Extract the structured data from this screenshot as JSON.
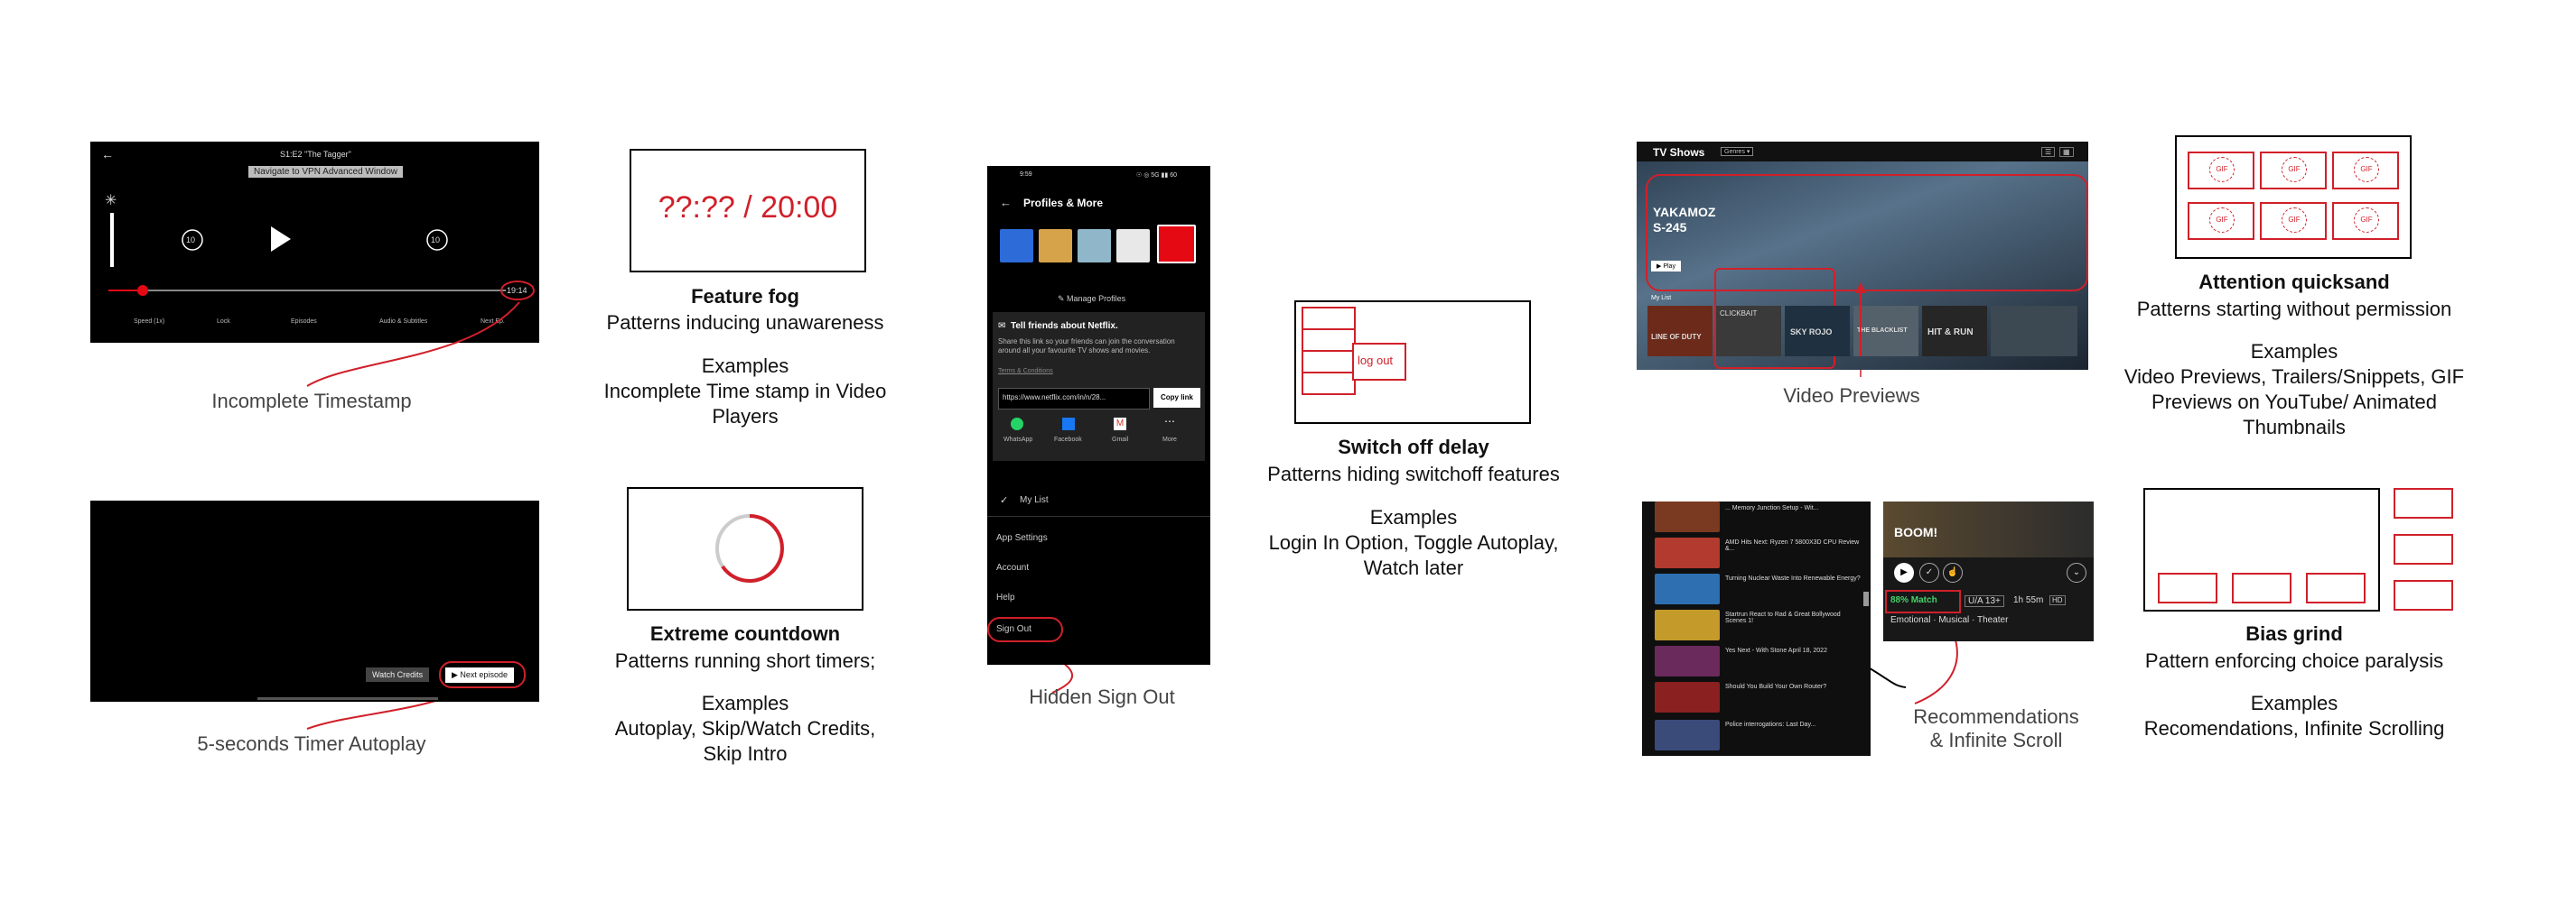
{
  "panel1": {
    "episode_title": "S1:E2 \"The Tagger\"",
    "vpn_banner": "Navigate to VPN Advanced Window",
    "skip_back": "10",
    "skip_fwd": "10",
    "timestamp": "19:14",
    "controls": [
      "Speed (1x)",
      "Lock",
      "Episodes",
      "Audio & Subtitles",
      "Next Ep."
    ],
    "caption": "Incomplete Timestamp"
  },
  "panel2": {
    "watch_credits": "Watch Credits",
    "next_episode": "Next episode",
    "caption": "5-seconds Timer Autoplay"
  },
  "feature_fog": {
    "display": "??:?? / 20:00",
    "title": "Feature fog",
    "subtitle": "Patterns inducing unawareness",
    "examples_label": "Examples",
    "examples": "Incomplete Time stamp in Video Players"
  },
  "extreme_countdown": {
    "title": "Extreme countdown",
    "subtitle": "Patterns running short timers;",
    "examples_label": "Examples",
    "examples": "Autoplay, Skip/Watch Credits, Skip Intro"
  },
  "phone": {
    "time": "9:59",
    "status_icons": "☉ ◎ 5G ▮▮ 60",
    "header": "Profiles & More",
    "manage_profiles": "Manage Profiles",
    "tell_friends": "Tell friends about Netflix.",
    "share_text": "Share this link so your friends can join the conversation around all your favourite TV shows and movies.",
    "terms": "Terms & Conditions",
    "link": "https://www.netflix.com/in/n/28...",
    "copy_link": "Copy link",
    "share_apps": [
      "WhatsApp",
      "Facebook",
      "Gmail",
      "More"
    ],
    "my_list": "My List",
    "menu": [
      "App Settings",
      "Account",
      "Help"
    ],
    "sign_out": "Sign Out",
    "caption": "Hidden Sign Out"
  },
  "switch_off": {
    "logout_label": "log out",
    "title": "Switch off delay",
    "subtitle": "Patterns hiding switchoff features",
    "examples_label": "Examples",
    "examples": "Login In Option, Toggle Autoplay, Watch later"
  },
  "tv_shows": {
    "header": "TV Shows",
    "genres": "Genres ▾",
    "show_title": "YAKAMOZ S-245",
    "play": "▶ Play",
    "my_list": "My List",
    "row_titles": [
      "LINE OF DUTY",
      "CLICKBAIT",
      "SKY ROJO",
      "THE BLACKLIST",
      "HIT & RUN",
      ""
    ],
    "caption": "Video Previews"
  },
  "attention": {
    "gif_label": "GIF",
    "title": "Attention quicksand",
    "subtitle": "Patterns starting without permission",
    "examples_label": "Examples",
    "examples": "Video Previews,  Trailers/Snippets, GIF Previews on YouTube/ Animated Thumbnails"
  },
  "youtube": {
    "items": [
      "... Memory Junction Setup - Wit...",
      "AMD Hits Next: Ryzen 7 5800X3D CPU Review &...",
      "Turning Nuclear Waste Into Renewable Energy?",
      "Startrun React to Rad & Great Bollywood Scenes 1!",
      "Yes Next - With Stone April 18, 2022",
      "Should You Build Your Own Router?",
      "Police interrogations: Last Day..."
    ]
  },
  "netflix_detail": {
    "title": "BOOM!",
    "match": "88% Match",
    "rating": "U/A 13+",
    "duration": "1h 55m",
    "quality": "HD",
    "genres": "Emotional · Musical · Theater",
    "caption": "Recommendations & Infinite Scroll"
  },
  "bias_grind": {
    "title": "Bias grind",
    "subtitle": "Pattern enforcing choice paralysis",
    "examples_label": "Examples",
    "examples": "Recomendations, Infinite Scrolling"
  },
  "colors": {
    "accent_red": "#d0202a",
    "netflix_red": "#e50914",
    "match_green": "#46d369"
  }
}
